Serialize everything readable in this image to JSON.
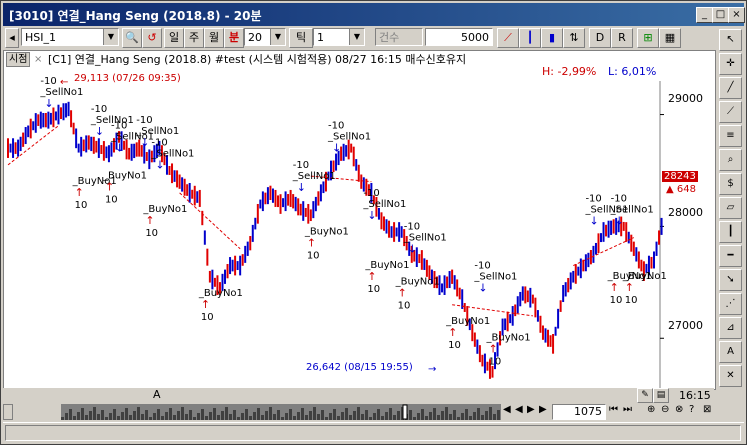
{
  "window": {
    "title": "[3010] 연결_Hang Seng (2018.8) - 20분",
    "controls": [
      "_",
      "□",
      "×"
    ]
  },
  "toolbar": {
    "symbol": "HSI_1",
    "btn_il": "일",
    "btn_ju": "주",
    "btn_wol": "월",
    "btn_bun": "분",
    "interval": "20",
    "btn_tick": "틱",
    "tick_value": "1",
    "count_label": "건수",
    "count_value": "5000"
  },
  "chart": {
    "tab_label": "시점",
    "info": "[C1]  연결_Hang Seng (2018.8) #test (시스템 시험적용) 08/27 16:15 매수신호유지",
    "high_label": "H: -2,99%",
    "low_label": "L: 6,01%",
    "y_ticks": [
      "29000",
      "28000",
      "27000"
    ],
    "price_box": "28243",
    "price_change": "▲ 648",
    "max_label": "29,113 (07/26 09:35)",
    "min_label": "26,642 (08/15 19:55)",
    "x_marker": "A",
    "time_label": "16:15",
    "zoom_value": "1075"
  },
  "chart_data": {
    "type": "line",
    "title": "",
    "series": [
      {
        "x": [
          0,
          10,
          20,
          30,
          40,
          50,
          60,
          70,
          80,
          90,
          100,
          110,
          120,
          130,
          140,
          150,
          160,
          170,
          180,
          190,
          200,
          210,
          220,
          230,
          240,
          250,
          260,
          270,
          280,
          290,
          300,
          310,
          320,
          330,
          340,
          350,
          360,
          370,
          380,
          390,
          400,
          410,
          420,
          430,
          440,
          450,
          460,
          470,
          480,
          490,
          500,
          510,
          520,
          530,
          540,
          550,
          560,
          570,
          580,
          590,
          600,
          610,
          620,
          630,
          640
        ],
        "values": [
          28700,
          28850,
          28950,
          28950,
          29000,
          29050,
          28700,
          28750,
          28700,
          28650,
          28800,
          28650,
          28700,
          28600,
          28700,
          28500,
          28400,
          28300,
          28250,
          27550,
          27450,
          27650,
          27650,
          27850,
          28200,
          28300,
          28200,
          28250,
          28150,
          28100,
          28300,
          28500,
          28650,
          28700,
          28400,
          28300,
          28050,
          27950,
          27950,
          27750,
          27700,
          27550,
          27450,
          27550,
          27350,
          27050,
          26800,
          26700,
          27100,
          27200,
          27400,
          27350,
          27050,
          26950,
          27400,
          27550,
          27650,
          27750,
          27950,
          28000,
          28000,
          27800,
          27600,
          27700,
          28100
        ]
      }
    ],
    "ylim": [
      26600,
      29300
    ],
    "signals": [
      {
        "label": "_SellNo1",
        "qty": "-10"
      },
      {
        "label": "_BuyNo1",
        "qty": "10"
      }
    ],
    "axis_labels": [
      "29000",
      "28000",
      "27000"
    ]
  },
  "right_tools": [
    "cursor",
    "crosshair",
    "line",
    "trend",
    "fib",
    "zoom",
    "price",
    "channel",
    "vline",
    "hline",
    "arrow",
    "fan",
    "gann",
    "text",
    "delete"
  ],
  "colors": {
    "candle_up": "#e00000",
    "candle_down": "#0000cc",
    "trend": "#e00000",
    "title_bar": "#0a246a"
  }
}
